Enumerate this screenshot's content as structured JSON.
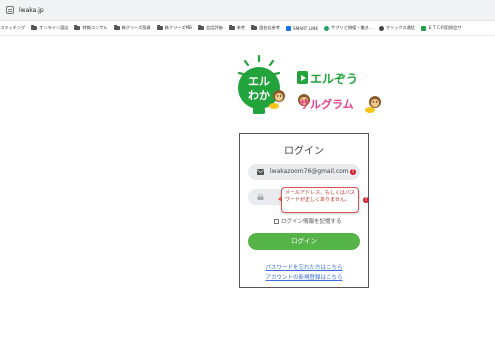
{
  "browser": {
    "url": "lwaka.jp",
    "bookmarks": [
      {
        "label": "コマッチング",
        "type": "text"
      },
      {
        "label": "オンライン語店",
        "type": "folder"
      },
      {
        "label": "特報コンサル",
        "type": "folder"
      },
      {
        "label": "株グリーズ版資",
        "type": "folder"
      },
      {
        "label": "株クリーズMB",
        "type": "folder"
      },
      {
        "label": "会話評価",
        "type": "folder"
      },
      {
        "label": "参考",
        "type": "folder"
      },
      {
        "label": "語芸店参考",
        "type": "folder"
      },
      {
        "label": "SMART LINK",
        "type": "site",
        "color": "#1a73e8"
      },
      {
        "label": "サグリと物組・働き...",
        "type": "site",
        "color": "#1ea362"
      },
      {
        "label": "オリックス通信",
        "type": "site",
        "color": "#444444"
      },
      {
        "label": "ＥＴＣ利用照会サ",
        "type": "site",
        "color": "#2a9d4b"
      }
    ]
  },
  "logo": {
    "left_text_line1": "エル",
    "left_text_line2": "わか",
    "brand1": "エルぞう",
    "brand2": "サルグラム",
    "green": "#22a33c",
    "pink": "#e83d8c"
  },
  "login": {
    "title": "ログイン",
    "email_value": "lwakazoom76@gmail.com",
    "password_value": "",
    "error_tooltip": "メールアドレス、もしくはパスワードが正しくありません。",
    "remember_label": "ログイン情報を記憶する",
    "login_button": "ログイン",
    "forgot_link": "パスワードを忘れた方はこちら",
    "signup_link": "アカウントの新規登録はこちら"
  }
}
